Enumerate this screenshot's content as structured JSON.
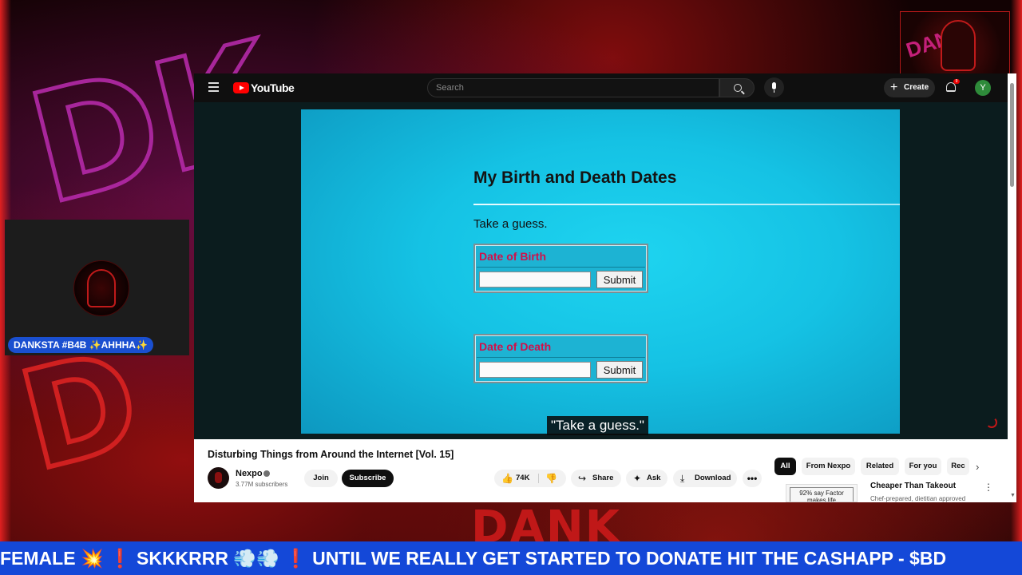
{
  "overlay": {
    "webcam_name": "DANKSTA #B4B ✨AHHHA✨",
    "ticker": "FEMALE 💥 ❗ SKKKRRR 💨💨 ❗ UNTIL WE REALLY GET STARTED TO DONATE HIT THE CASHAPP - $BD",
    "colors": {
      "accent_red": "#d02020",
      "ticker_blue": "#1448d8"
    }
  },
  "youtube": {
    "logo": "YouTube",
    "search": {
      "placeholder": "Search"
    },
    "create_label": "Create",
    "notification_count": "9",
    "avatar_letter": "Y"
  },
  "video": {
    "slide_title": "My Birth and Death Dates",
    "slide_subtitle": "Take a guess.",
    "fields": [
      {
        "label": "Date of Birth",
        "button": "Submit"
      },
      {
        "label": "Date of Death",
        "button": "Submit"
      }
    ],
    "caption": "\"Take a guess.\""
  },
  "info": {
    "title": "Disturbing Things from Around the Internet [Vol. 15]",
    "channel": "Nexpo",
    "subscribers": "3.77M subscribers",
    "join_label": "Join",
    "subscribe_label": "Subscribe",
    "likes": "74K",
    "share_label": "Share",
    "ask_label": "Ask",
    "download_label": "Download"
  },
  "chips": [
    "All",
    "From Nexpo",
    "Related",
    "For you",
    "Rec"
  ],
  "recommendation": {
    "thumb_text": "92% say Factor makes life",
    "title": "Cheaper Than Takeout",
    "desc": "Chef-prepared, dietitian approved"
  }
}
